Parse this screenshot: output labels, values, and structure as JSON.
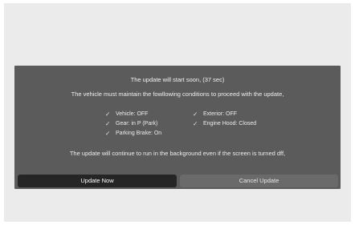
{
  "dialog": {
    "title": "The update will start soon, (37 sec)",
    "subtitle": "The vehicle must maintain the fowllowing conditions to proceed with the update,",
    "conditions": [
      {
        "icon": "checkmark-icon",
        "label": "Vehicle: OFF"
      },
      {
        "icon": "checkmark-icon",
        "label": "Gear: in P (Park)"
      },
      {
        "icon": "checkmark-icon",
        "label": "Parking Brake: On"
      },
      {
        "icon": "checkmark-icon",
        "label": "Exterior: OFF"
      },
      {
        "icon": "checkmark-icon",
        "label": "Engine Hood: Closed"
      }
    ],
    "note": "The update will continue to run in the background even if the screen is turned dff,",
    "buttons": {
      "update_now": "Update Now",
      "cancel_update": "Cancel Update"
    }
  },
  "colors": {
    "screen_background": "#ebebeb",
    "dialog_background": "#5b5b5b",
    "primary_button": "#252525",
    "secondary_button": "#6a6a6a",
    "text": "#eeeeee"
  }
}
